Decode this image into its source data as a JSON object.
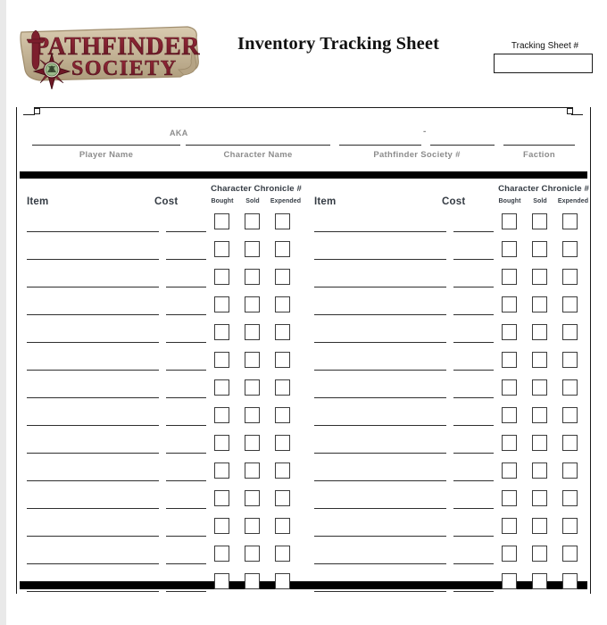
{
  "document": {
    "title": "Inventory Tracking Sheet",
    "brand_name": "Pathfinder Society",
    "brand_line1": "PATHFINDER",
    "brand_line2": "SOCIETY"
  },
  "tracking": {
    "label": "Tracking Sheet #",
    "value": ""
  },
  "identity": {
    "aka_label": "AKA",
    "dash": "-",
    "fields": [
      {
        "label": "Player Name",
        "value": ""
      },
      {
        "label": "Character Name",
        "value": ""
      },
      {
        "label": "Pathfinder Society #",
        "value": ""
      },
      {
        "label": "Faction",
        "value": ""
      }
    ]
  },
  "table": {
    "headers": {
      "item": "Item",
      "cost": "Cost",
      "chronicle": "Character Chronicle #",
      "bought": "Bought",
      "sold": "Sold",
      "expended": "Expended"
    },
    "row_count": 14,
    "left_rows": [
      {
        "item": "",
        "cost": "",
        "bought": false,
        "sold": false,
        "expended": false
      },
      {
        "item": "",
        "cost": "",
        "bought": false,
        "sold": false,
        "expended": false
      },
      {
        "item": "",
        "cost": "",
        "bought": false,
        "sold": false,
        "expended": false
      },
      {
        "item": "",
        "cost": "",
        "bought": false,
        "sold": false,
        "expended": false
      },
      {
        "item": "",
        "cost": "",
        "bought": false,
        "sold": false,
        "expended": false
      },
      {
        "item": "",
        "cost": "",
        "bought": false,
        "sold": false,
        "expended": false
      },
      {
        "item": "",
        "cost": "",
        "bought": false,
        "sold": false,
        "expended": false
      },
      {
        "item": "",
        "cost": "",
        "bought": false,
        "sold": false,
        "expended": false
      },
      {
        "item": "",
        "cost": "",
        "bought": false,
        "sold": false,
        "expended": false
      },
      {
        "item": "",
        "cost": "",
        "bought": false,
        "sold": false,
        "expended": false
      },
      {
        "item": "",
        "cost": "",
        "bought": false,
        "sold": false,
        "expended": false
      },
      {
        "item": "",
        "cost": "",
        "bought": false,
        "sold": false,
        "expended": false
      },
      {
        "item": "",
        "cost": "",
        "bought": false,
        "sold": false,
        "expended": false
      },
      {
        "item": "",
        "cost": "",
        "bought": false,
        "sold": false,
        "expended": false
      }
    ],
    "right_rows": [
      {
        "item": "",
        "cost": "",
        "bought": false,
        "sold": false,
        "expended": false
      },
      {
        "item": "",
        "cost": "",
        "bought": false,
        "sold": false,
        "expended": false
      },
      {
        "item": "",
        "cost": "",
        "bought": false,
        "sold": false,
        "expended": false
      },
      {
        "item": "",
        "cost": "",
        "bought": false,
        "sold": false,
        "expended": false
      },
      {
        "item": "",
        "cost": "",
        "bought": false,
        "sold": false,
        "expended": false
      },
      {
        "item": "",
        "cost": "",
        "bought": false,
        "sold": false,
        "expended": false
      },
      {
        "item": "",
        "cost": "",
        "bought": false,
        "sold": false,
        "expended": false
      },
      {
        "item": "",
        "cost": "",
        "bought": false,
        "sold": false,
        "expended": false
      },
      {
        "item": "",
        "cost": "",
        "bought": false,
        "sold": false,
        "expended": false
      },
      {
        "item": "",
        "cost": "",
        "bought": false,
        "sold": false,
        "expended": false
      },
      {
        "item": "",
        "cost": "",
        "bought": false,
        "sold": false,
        "expended": false
      },
      {
        "item": "",
        "cost": "",
        "bought": false,
        "sold": false,
        "expended": false
      },
      {
        "item": "",
        "cost": "",
        "bought": false,
        "sold": false,
        "expended": false
      },
      {
        "item": "",
        "cost": "",
        "bought": false,
        "sold": false,
        "expended": false
      }
    ]
  },
  "colors": {
    "logo_red": "#8b2332",
    "logo_dark_red": "#5e1620",
    "logo_parchment": "#c9b89a",
    "logo_green": "#9ab98a",
    "header_text": "#353c44",
    "label_gray": "#8c8c8c",
    "rule": "#2f2f2f",
    "bar": "#000000"
  }
}
